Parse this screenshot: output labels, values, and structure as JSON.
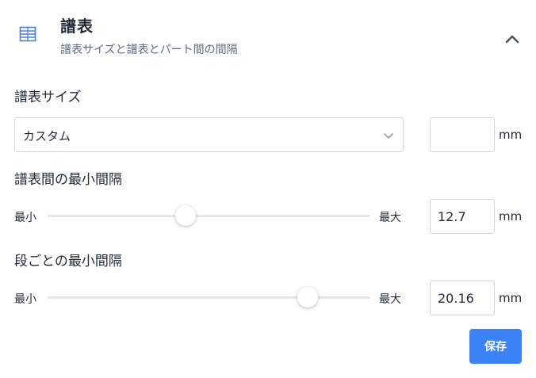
{
  "header": {
    "icon": "staff-lines-icon",
    "title": "譜表",
    "subtitle": "譜表サイズと譜表とパート間の間隔",
    "collapse_icon": "chevron-up-icon"
  },
  "staff_size": {
    "label": "譜表サイズ",
    "select_value": "カスタム",
    "input_value": "",
    "unit": "mm"
  },
  "min_staff_spacing": {
    "label": "譜表間の最小間隔",
    "min_label": "最小",
    "max_label": "最大",
    "slider_fraction": 0.428,
    "input_value": "12.7",
    "unit": "mm"
  },
  "min_system_spacing": {
    "label": "段ごとの最小間隔",
    "min_label": "最小",
    "max_label": "最大",
    "slider_fraction": 0.807,
    "input_value": "20.16",
    "unit": "mm"
  },
  "save_label": "保存",
  "colors": {
    "accent": "#3b82f6",
    "icon": "#4a7fd4",
    "chevron": "#4b5563"
  }
}
